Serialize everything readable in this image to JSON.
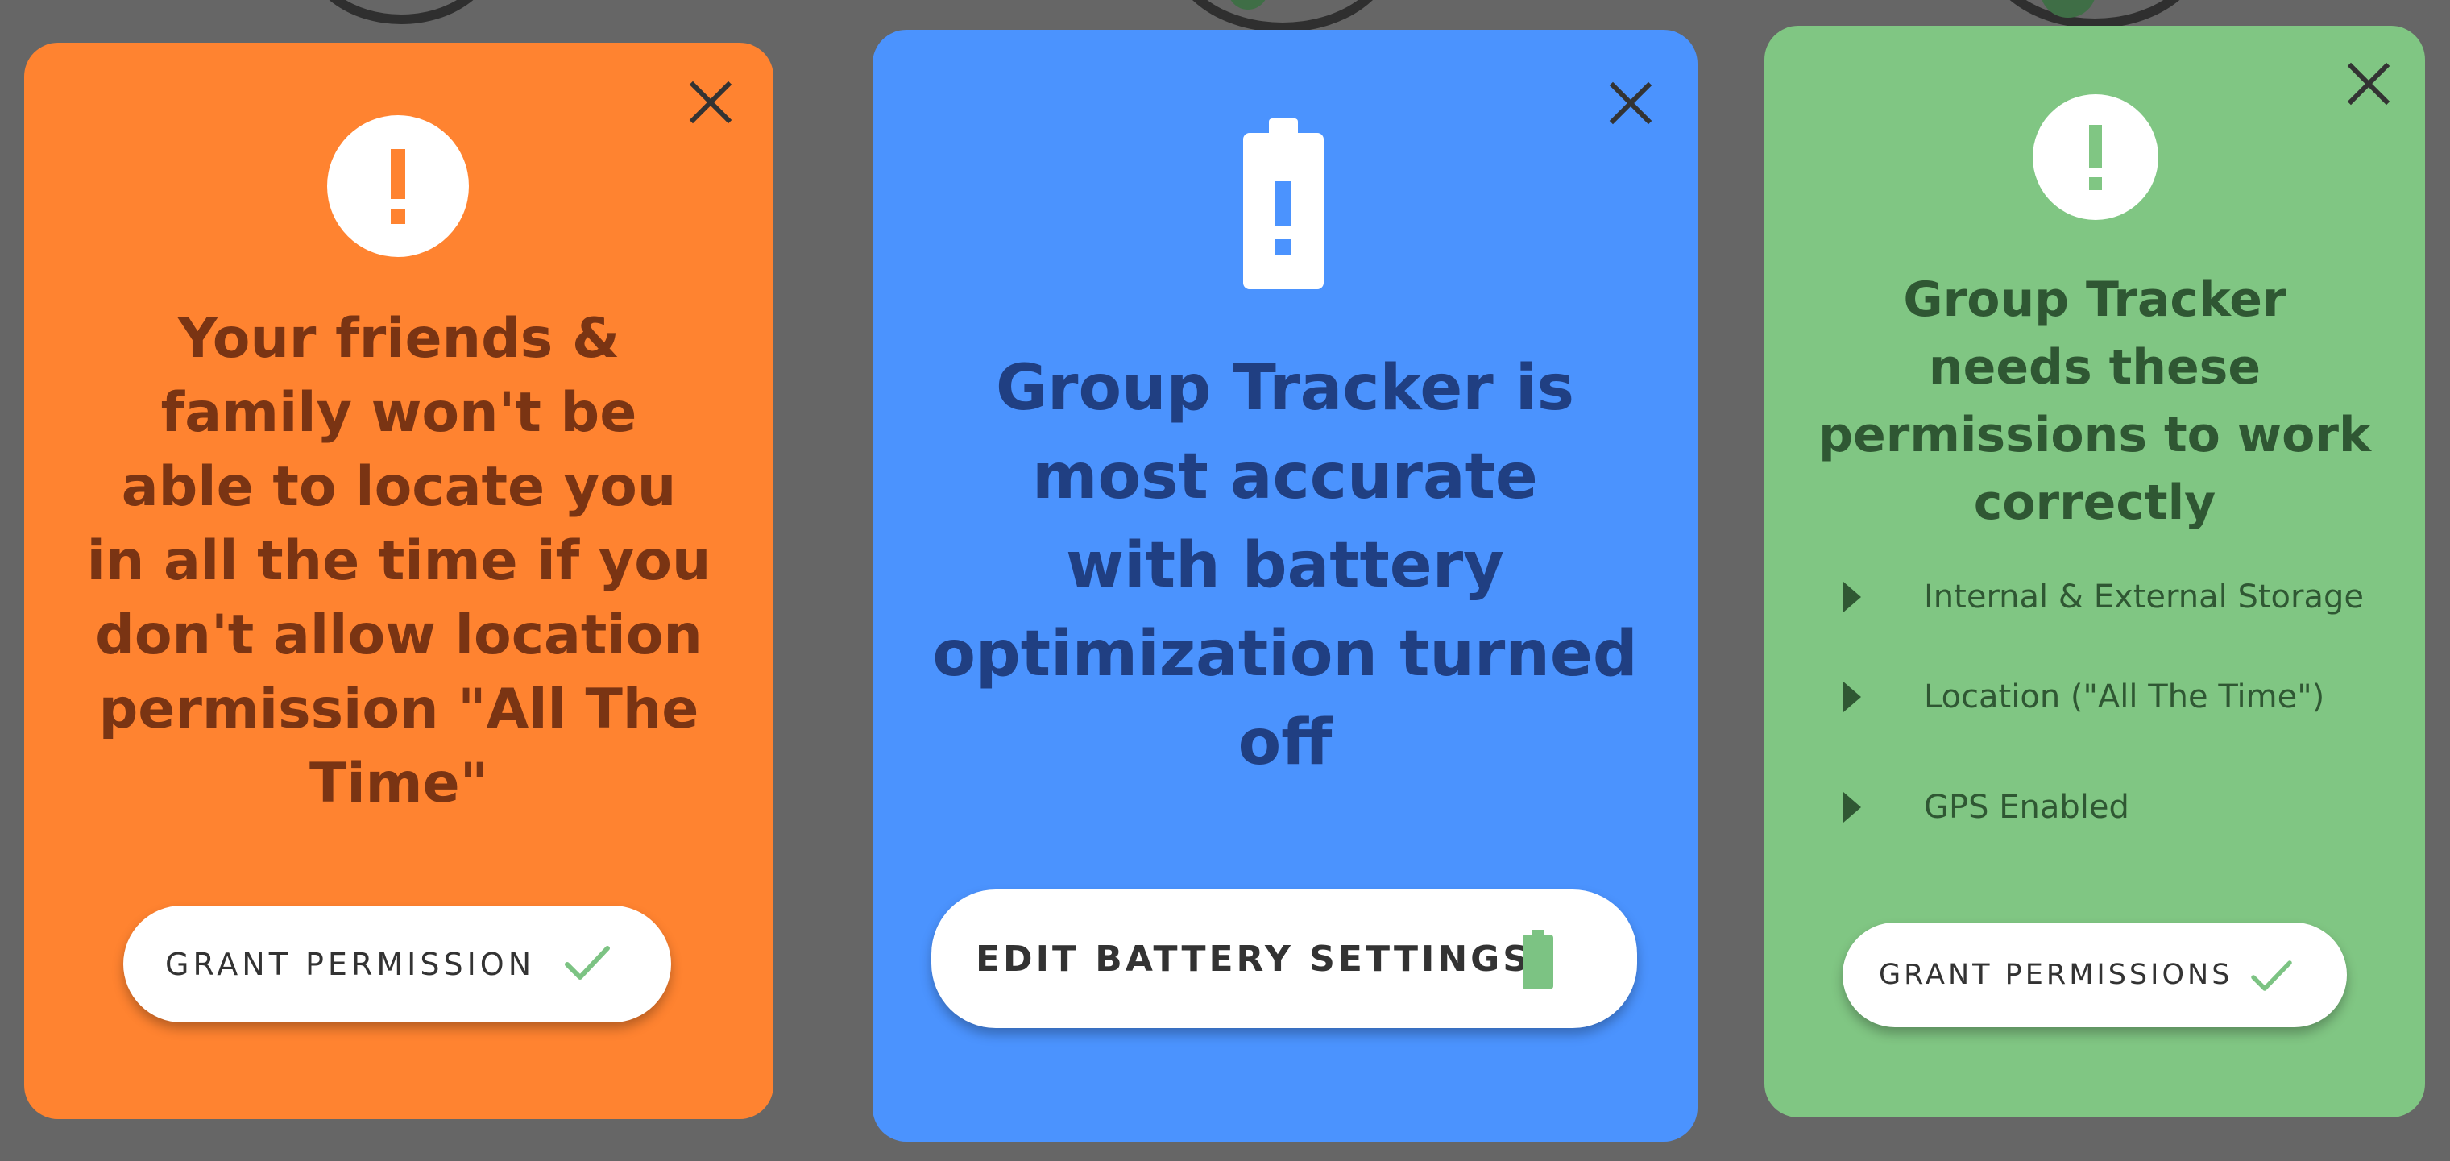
{
  "colors": {
    "background": "#666666",
    "warning_card": "#ff8330",
    "warning_text": "#7a3413",
    "battery_card": "#4b93fe",
    "battery_text": "#203f82",
    "permissions_card": "#80c683",
    "permissions_text": "#2f5733",
    "check_green": "#7cc383"
  },
  "cards": {
    "location_warning": {
      "close_icon": "close-icon",
      "alert_icon": "exclamation-circle-icon",
      "message_lines": [
        "Your friends &",
        "family won't be",
        "able to locate you",
        "in all the time if you",
        "don't allow location",
        "permission \"All The",
        "Time\""
      ],
      "button_label": "GRANT PERMISSION",
      "button_icon": "checkmark-icon"
    },
    "battery": {
      "close_icon": "close-icon",
      "battery_icon": "battery-alert-icon",
      "message_lines": [
        "Group Tracker is",
        "most accurate",
        "with battery",
        "optimization turned",
        "off"
      ],
      "button_label": "EDIT BATTERY SETTINGS",
      "button_icon": "battery-full-icon"
    },
    "permissions": {
      "close_icon": "close-icon",
      "alert_icon": "exclamation-circle-icon",
      "message_lines": [
        "Group Tracker",
        "needs these",
        "permissions to work",
        "correctly"
      ],
      "permissions": [
        "Internal & External Storage",
        "Location (\"All The Time\")",
        "GPS Enabled"
      ],
      "bullet_icon": "triangle-right-icon",
      "button_label": "GRANT PERMISSIONS",
      "button_icon": "checkmark-icon"
    }
  }
}
